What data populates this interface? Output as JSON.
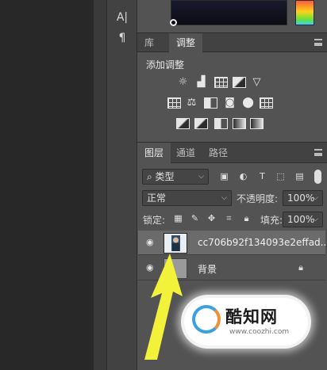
{
  "tools": [
    {
      "icon": "text-tool-icon",
      "glyph": "A|"
    },
    {
      "icon": "paragraph-icon",
      "glyph": "¶"
    }
  ],
  "top_tabs": {
    "library": "库",
    "adjustments": "调整"
  },
  "adjustments": {
    "title": "添加调整",
    "row1": [
      "brightness-icon",
      "levels-icon",
      "curves-icon",
      "exposure-icon",
      "vibrance-icon"
    ],
    "row2": [
      "hue-saturation-icon",
      "color-balance-icon",
      "black-white-icon",
      "photo-filter-icon",
      "channel-mixer-icon",
      "color-lookup-icon"
    ],
    "row3": [
      "invert-icon",
      "posterize-icon",
      "threshold-icon",
      "gradient-map-icon",
      "selective-color-icon"
    ]
  },
  "layers_tabs": {
    "layers": "图层",
    "channels": "通道",
    "paths": "路径"
  },
  "filter": {
    "kind_label": "类型"
  },
  "blend": {
    "mode": "正常",
    "opacity_label": "不透明度:",
    "opacity_value": "100%"
  },
  "lock": {
    "label": "锁定:",
    "fill_label": "填充:",
    "fill_value": "100%"
  },
  "layers": [
    {
      "name": "cc706b92f134093e2effad...",
      "selected": true
    },
    {
      "name": "背景",
      "locked": true
    }
  ],
  "watermark": {
    "title": "酷知网",
    "url": "www.coozhi.com"
  },
  "colors": {
    "panel": "#535353",
    "selected_row": "#6b6b6b",
    "arrow": "#f2f23a"
  }
}
